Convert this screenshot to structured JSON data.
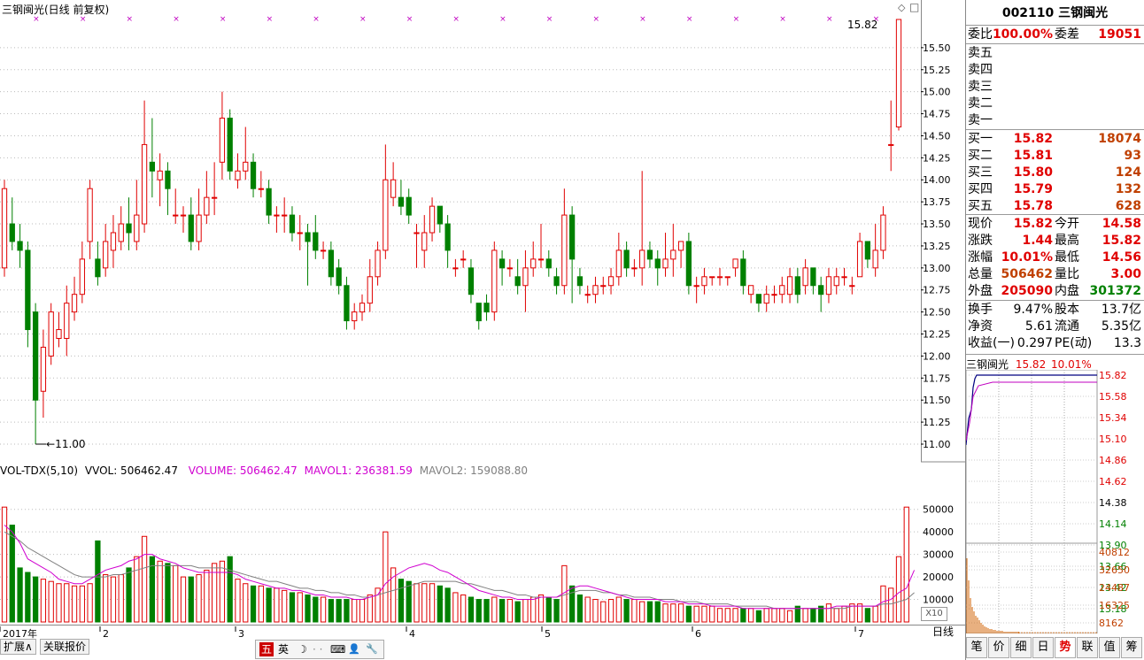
{
  "title": "三钢闽光(日线 前复权)",
  "top_right_icons": [
    "◇",
    "□"
  ],
  "last_price_label": "15.82",
  "low_price_label": "11.00",
  "price_axis": [
    "15.50",
    "15.25",
    "15.00",
    "14.75",
    "14.50",
    "14.25",
    "14.00",
    "13.75",
    "13.50",
    "13.25",
    "13.00",
    "12.75",
    "12.50",
    "12.25",
    "12.00",
    "11.75",
    "11.50",
    "11.25",
    "11.00"
  ],
  "vol_title": {
    "name": "VOL-TDX(5,10)",
    "vvol": "VVOL: 506462.47",
    "volume": "VOLUME: 506462.47",
    "mavol1": "MAVOL1: 236381.59",
    "mavol2": "MAVOL2: 159088.80"
  },
  "vol_axis": [
    "50000",
    "40000",
    "30000",
    "20000",
    "10000"
  ],
  "vol_unit": "X10",
  "time_axis": [
    "2017年",
    "2",
    "3",
    "4",
    "5",
    "6",
    "7"
  ],
  "period_label": "日线",
  "bottom_buttons": {
    "expand": "扩展∧",
    "related": "关联报价"
  },
  "ime": {
    "ch": "五",
    "en": "英",
    "moon": "☽",
    "dots": "· ·",
    "kb": "⌨",
    "user": "👤",
    "wrench": "🔧"
  },
  "quote": {
    "code": "002110",
    "name": "三钢闽光",
    "weibi_label": "委比",
    "weibi": "100.00%",
    "weicha_label": "委差",
    "weicha": "19051",
    "sell": [
      {
        "label": "卖五",
        "price": "",
        "vol": ""
      },
      {
        "label": "卖四",
        "price": "",
        "vol": ""
      },
      {
        "label": "卖三",
        "price": "",
        "vol": ""
      },
      {
        "label": "卖二",
        "price": "",
        "vol": ""
      },
      {
        "label": "卖一",
        "price": "",
        "vol": ""
      }
    ],
    "buy": [
      {
        "label": "买一",
        "price": "15.82",
        "vol": "18074"
      },
      {
        "label": "买二",
        "price": "15.81",
        "vol": "93"
      },
      {
        "label": "买三",
        "price": "15.80",
        "vol": "124"
      },
      {
        "label": "买四",
        "price": "15.79",
        "vol": "132"
      },
      {
        "label": "买五",
        "price": "15.78",
        "vol": "628"
      }
    ],
    "stats": [
      {
        "l1": "现价",
        "v1": "15.82",
        "c1": "red",
        "l2": "今开",
        "v2": "14.58",
        "c2": "red"
      },
      {
        "l1": "涨跌",
        "v1": "1.44",
        "c1": "red",
        "l2": "最高",
        "v2": "15.82",
        "c2": "red"
      },
      {
        "l1": "涨幅",
        "v1": "10.01%",
        "c1": "red",
        "l2": "最低",
        "v2": "14.56",
        "c2": "red"
      },
      {
        "l1": "总量",
        "v1": "506462",
        "c1": "orng",
        "l2": "量比",
        "v2": "3.00",
        "c2": "red"
      },
      {
        "l1": "外盘",
        "v1": "205090",
        "c1": "red",
        "l2": "内盘",
        "v2": "301372",
        "c2": "green"
      }
    ],
    "stats2": [
      {
        "l1": "换手",
        "v1": "9.47%",
        "c1": "blk",
        "l2": "股本",
        "v2": "13.7亿",
        "c2": "blk"
      },
      {
        "l1": "净资",
        "v1": "5.61",
        "c1": "blk",
        "l2": "流通",
        "v2": "5.35亿",
        "c2": "blk"
      },
      {
        "l1": "收益(一)",
        "v1": "0.297",
        "c1": "blk",
        "l2": "PE(动)",
        "v2": "13.3",
        "c2": "blk"
      }
    ]
  },
  "minichart": {
    "title": "三钢闽光",
    "price": "15.82",
    "pct": "10.01%",
    "price_axis_red": [
      "15.82",
      "15.58",
      "15.34",
      "15.10",
      "14.86",
      "14.62"
    ],
    "price_axis_black": [
      "14.38"
    ],
    "price_axis_green": [
      "14.14",
      "13.90",
      "13.66",
      "13.42",
      "13.18"
    ],
    "vol_axis": [
      "40812",
      "32650",
      "24487",
      "16325",
      "8162"
    ]
  },
  "right_tabs": [
    "笔",
    "价",
    "细",
    "日",
    "势",
    "联",
    "值",
    "筹"
  ],
  "active_tab": "势",
  "colors": {
    "up": "#e00000",
    "down": "#008000",
    "ma1": "#d000d0",
    "ma2": "#808080",
    "bg": "#ffffff"
  },
  "chart_data": {
    "type": "candlestick",
    "ylim": [
      11.0,
      15.82
    ],
    "candles": [
      [
        13.0,
        13.9,
        14.0,
        12.9
      ],
      [
        13.5,
        13.3,
        13.8,
        13.2
      ],
      [
        13.3,
        13.2,
        13.5,
        13.0
      ],
      [
        13.2,
        12.3,
        13.3,
        12.1
      ],
      [
        12.5,
        11.5,
        12.6,
        11.0
      ],
      [
        11.6,
        12.1,
        12.3,
        11.3
      ],
      [
        12.0,
        12.5,
        12.6,
        11.9
      ],
      [
        12.2,
        12.3,
        12.5,
        12.1
      ],
      [
        12.2,
        12.6,
        12.8,
        12.0
      ],
      [
        12.5,
        12.7,
        12.9,
        12.4
      ],
      [
        12.7,
        13.1,
        13.3,
        12.6
      ],
      [
        13.3,
        13.9,
        14.0,
        13.1
      ],
      [
        13.1,
        12.9,
        13.3,
        12.8
      ],
      [
        13.0,
        13.3,
        13.5,
        12.9
      ],
      [
        13.2,
        13.4,
        13.6,
        13.0
      ],
      [
        13.3,
        13.5,
        13.7,
        13.2
      ],
      [
        13.5,
        13.4,
        13.8,
        13.2
      ],
      [
        13.3,
        13.6,
        14.0,
        13.2
      ],
      [
        13.5,
        14.4,
        14.9,
        13.4
      ],
      [
        14.2,
        14.1,
        14.7,
        13.8
      ],
      [
        14.0,
        14.1,
        14.3,
        13.7
      ],
      [
        14.1,
        13.9,
        14.2,
        13.6
      ],
      [
        13.6,
        13.6,
        13.9,
        13.5
      ],
      [
        13.6,
        13.6,
        13.7,
        13.4
      ],
      [
        13.6,
        13.3,
        13.8,
        13.2
      ],
      [
        13.3,
        13.6,
        13.9,
        13.2
      ],
      [
        13.6,
        13.8,
        14.1,
        13.5
      ],
      [
        13.8,
        13.8,
        14.2,
        13.6
      ],
      [
        14.2,
        14.7,
        15.0,
        14.0
      ],
      [
        14.7,
        14.1,
        14.8,
        14.0
      ],
      [
        14.0,
        14.1,
        14.3,
        13.9
      ],
      [
        14.1,
        14.2,
        14.6,
        14.0
      ],
      [
        14.2,
        13.9,
        14.3,
        13.8
      ],
      [
        13.9,
        13.9,
        14.1,
        13.8
      ],
      [
        13.9,
        13.6,
        14.0,
        13.5
      ],
      [
        13.6,
        13.6,
        13.7,
        13.4
      ],
      [
        13.6,
        13.6,
        13.8,
        13.4
      ],
      [
        13.6,
        13.4,
        13.7,
        13.3
      ],
      [
        13.4,
        13.4,
        13.6,
        13.2
      ],
      [
        13.4,
        13.3,
        13.5,
        12.8
      ],
      [
        13.4,
        13.2,
        13.6,
        13.1
      ],
      [
        13.2,
        13.2,
        13.3,
        13.1
      ],
      [
        13.2,
        12.9,
        13.3,
        12.8
      ],
      [
        13.0,
        12.8,
        13.1,
        12.7
      ],
      [
        12.8,
        12.4,
        12.9,
        12.3
      ],
      [
        12.4,
        12.5,
        12.6,
        12.3
      ],
      [
        12.5,
        12.6,
        12.7,
        12.4
      ],
      [
        12.6,
        12.9,
        13.1,
        12.5
      ],
      [
        12.9,
        13.2,
        13.3,
        12.8
      ],
      [
        13.2,
        14.0,
        14.4,
        13.1
      ],
      [
        13.8,
        14.0,
        14.2,
        13.7
      ],
      [
        13.8,
        13.7,
        14.0,
        13.6
      ],
      [
        13.8,
        13.6,
        13.9,
        13.5
      ],
      [
        13.4,
        13.4,
        13.5,
        13.0
      ],
      [
        13.2,
        13.4,
        13.6,
        13.0
      ],
      [
        13.4,
        13.7,
        13.8,
        13.3
      ],
      [
        13.7,
        13.5,
        13.7,
        13.4
      ],
      [
        13.5,
        13.2,
        13.6,
        13.0
      ],
      [
        13.0,
        13.0,
        13.1,
        12.9
      ],
      [
        13.1,
        13.1,
        13.2,
        13.0
      ],
      [
        13.0,
        12.7,
        13.1,
        12.6
      ],
      [
        12.6,
        12.4,
        12.6,
        12.3
      ],
      [
        12.6,
        12.5,
        12.7,
        12.4
      ],
      [
        12.5,
        13.2,
        13.3,
        12.4
      ],
      [
        13.1,
        13.0,
        13.2,
        12.8
      ],
      [
        13.0,
        13.0,
        13.1,
        12.9
      ],
      [
        12.9,
        12.8,
        13.1,
        12.7
      ],
      [
        12.8,
        13.0,
        13.2,
        12.5
      ],
      [
        13.0,
        13.1,
        13.3,
        12.9
      ],
      [
        13.1,
        13.1,
        13.5,
        13.0
      ],
      [
        13.1,
        13.0,
        13.2,
        12.9
      ],
      [
        12.9,
        12.8,
        13.0,
        12.7
      ],
      [
        12.8,
        13.6,
        13.9,
        12.7
      ],
      [
        13.6,
        13.1,
        13.7,
        12.6
      ],
      [
        12.9,
        12.8,
        13.0,
        12.7
      ],
      [
        12.7,
        12.7,
        12.8,
        12.6
      ],
      [
        12.7,
        12.8,
        12.9,
        12.6
      ],
      [
        12.8,
        12.8,
        12.9,
        12.7
      ],
      [
        12.8,
        12.9,
        13.0,
        12.7
      ],
      [
        12.9,
        13.2,
        13.4,
        12.8
      ],
      [
        13.2,
        13.0,
        13.3,
        12.9
      ],
      [
        13.0,
        13.0,
        13.1,
        12.9
      ],
      [
        13.0,
        13.2,
        14.1,
        12.8
      ],
      [
        13.2,
        13.1,
        13.3,
        13.0
      ],
      [
        13.1,
        13.0,
        13.2,
        12.8
      ],
      [
        13.0,
        13.1,
        13.4,
        12.9
      ],
      [
        13.1,
        13.2,
        13.5,
        12.9
      ],
      [
        13.2,
        13.3,
        13.3,
        13.0
      ],
      [
        13.3,
        12.8,
        13.4,
        12.7
      ],
      [
        12.8,
        12.8,
        12.9,
        12.6
      ],
      [
        12.8,
        12.9,
        13.0,
        12.7
      ],
      [
        12.9,
        12.9,
        12.9,
        12.8
      ],
      [
        12.9,
        12.9,
        13.0,
        12.8
      ],
      [
        12.9,
        12.9,
        12.9,
        12.8
      ],
      [
        13.0,
        13.1,
        13.1,
        12.9
      ],
      [
        13.1,
        12.8,
        13.2,
        12.7
      ],
      [
        12.7,
        12.8,
        12.8,
        12.6
      ],
      [
        12.7,
        12.6,
        12.7,
        12.5
      ],
      [
        12.6,
        12.7,
        12.8,
        12.5
      ],
      [
        12.7,
        12.7,
        12.8,
        12.6
      ],
      [
        12.7,
        12.8,
        12.9,
        12.6
      ],
      [
        12.7,
        12.9,
        13.0,
        12.6
      ],
      [
        12.9,
        12.7,
        13.0,
        12.6
      ],
      [
        12.8,
        13.0,
        13.1,
        12.7
      ],
      [
        13.0,
        12.8,
        13.0,
        12.7
      ],
      [
        12.8,
        12.7,
        12.9,
        12.5
      ],
      [
        12.7,
        12.9,
        13.0,
        12.6
      ],
      [
        12.8,
        12.9,
        13.0,
        12.7
      ],
      [
        12.9,
        12.9,
        13.0,
        12.8
      ],
      [
        12.8,
        12.8,
        12.9,
        12.7
      ],
      [
        12.9,
        13.3,
        13.4,
        12.9
      ],
      [
        13.3,
        13.1,
        13.3,
        13.0
      ],
      [
        13.0,
        13.2,
        13.5,
        12.9
      ],
      [
        13.2,
        13.6,
        13.7,
        13.1
      ],
      [
        14.4,
        14.4,
        14.9,
        14.1
      ],
      [
        14.6,
        15.82,
        15.82,
        14.56
      ]
    ],
    "volumes": [
      51,
      43,
      24,
      22,
      20,
      19,
      18,
      17,
      17,
      16,
      16,
      17,
      36,
      21,
      20,
      21,
      24,
      29,
      38,
      29,
      27,
      26,
      25,
      20,
      20,
      21,
      23,
      26,
      27,
      29,
      19,
      17,
      16,
      16,
      15,
      15,
      14,
      13,
      13,
      12,
      11,
      11,
      10,
      10,
      10,
      10,
      10,
      12,
      15,
      40,
      24,
      19,
      18,
      17,
      17,
      17,
      16,
      15,
      13,
      12,
      11,
      10,
      10,
      11,
      10,
      10,
      9,
      10,
      11,
      12,
      11,
      10,
      25,
      16,
      12,
      11,
      10,
      9,
      10,
      11,
      10,
      10,
      9,
      9,
      9,
      8,
      8,
      8,
      7,
      7,
      7,
      7,
      6,
      6,
      6,
      6,
      6,
      5,
      6,
      6,
      6,
      5,
      7,
      6,
      6,
      7,
      8,
      6,
      7,
      8,
      8,
      6,
      7,
      16,
      15,
      29,
      51
    ],
    "mavol1_series_values": [
      43,
      40,
      35,
      28,
      26,
      24,
      22,
      19,
      18,
      17,
      17,
      19,
      21,
      23,
      24,
      25,
      27,
      28,
      30,
      30,
      28,
      27,
      26,
      24,
      23,
      22,
      22,
      22,
      22,
      22,
      21,
      19,
      18,
      17,
      16,
      15,
      15,
      14,
      14,
      13,
      12,
      12,
      11,
      11,
      11,
      10,
      10,
      11,
      12,
      17,
      20,
      22,
      24,
      25,
      26,
      25,
      23,
      22,
      20,
      18,
      16,
      14,
      13,
      12,
      11,
      11,
      10,
      10,
      10,
      11,
      11,
      11,
      13,
      15,
      16,
      16,
      15,
      14,
      13,
      12,
      11,
      10,
      10,
      10,
      10,
      9,
      9,
      9,
      8,
      8,
      8,
      7,
      7,
      7,
      7,
      6,
      6,
      6,
      6,
      6,
      6,
      6,
      6,
      6,
      6,
      6,
      6,
      7,
      7,
      7,
      7,
      7,
      7,
      9,
      10,
      13,
      15,
      23
    ],
    "mavol2_series_values": [
      40,
      38,
      36,
      33,
      31,
      29,
      27,
      25,
      23,
      21,
      20,
      20,
      20,
      20,
      21,
      21,
      22,
      23,
      24,
      25,
      25,
      25,
      25,
      25,
      25,
      24,
      24,
      24,
      24,
      23,
      22,
      21,
      20,
      19,
      18,
      18,
      17,
      16,
      15,
      15,
      14,
      14,
      13,
      13,
      12,
      12,
      11,
      11,
      12,
      13,
      14,
      15,
      16,
      17,
      18,
      18,
      18,
      18,
      18,
      17,
      17,
      16,
      15,
      14,
      14,
      13,
      12,
      12,
      11,
      11,
      11,
      11,
      12,
      13,
      14,
      14,
      14,
      13,
      13,
      12,
      12,
      11,
      11,
      11,
      10,
      10,
      10,
      9,
      9,
      9,
      8,
      8,
      8,
      8,
      7,
      7,
      7,
      7,
      7,
      6,
      6,
      6,
      6,
      6,
      6,
      6,
      6,
      6,
      6,
      7,
      7,
      7,
      7,
      8,
      8,
      9,
      10,
      13
    ]
  }
}
